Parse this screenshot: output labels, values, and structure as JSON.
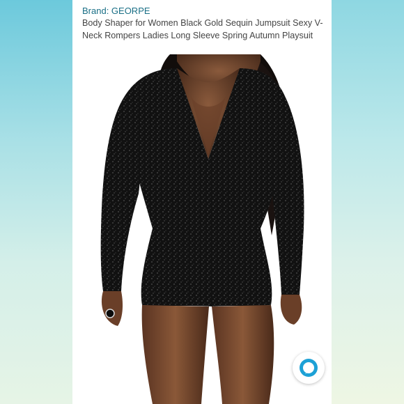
{
  "product": {
    "brand_label": "Brand: GEORPE",
    "title": "Body Shaper for Women Black Gold Sequin Jumpsuit Sexy V-Neck Rompers Ladies Long Sleeve Spring Autumn Playsuit"
  },
  "photo": {
    "subject": "model-in-black-sequin-romper"
  },
  "assistant_button": {
    "icon": "alexa-icon"
  },
  "colors": {
    "brand_link": "#1a6f86",
    "title_text": "#444444",
    "background_gradient_top": "#7fd3e0",
    "background_gradient_bottom": "#e9f5ec",
    "assistant_accent": "#1da1d6"
  }
}
